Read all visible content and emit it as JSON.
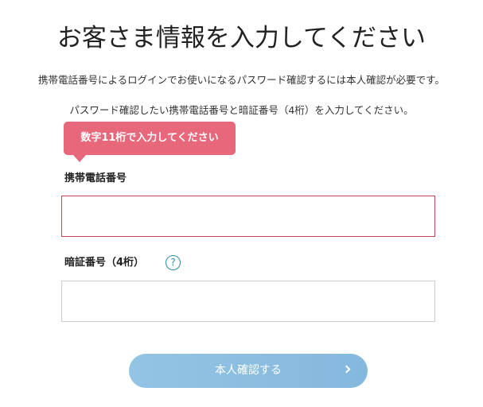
{
  "title": "お客さま情報を入力してください",
  "description": {
    "line1": "携帯電話番号によるログインでお使いになるパスワード確認するには本人確認が必要です。",
    "line2": "パスワード確認したい携帯電話番号と暗証番号（4桁）を入力してください。"
  },
  "tooltip": {
    "text": "数字11桁で入力してください",
    "color": "#e8687b"
  },
  "fields": {
    "phone": {
      "label": "携帯電話番号",
      "value": "",
      "placeholder": "",
      "state": "error",
      "border_color": "#c9435a"
    },
    "pin": {
      "label": "暗証番号（4桁）",
      "value": "",
      "placeholder": "",
      "help_icon": "question-icon",
      "help_symbol": "?"
    }
  },
  "submit": {
    "label": "本人確認する",
    "icon": "chevron-right-icon",
    "color": "#8ebfe1"
  }
}
